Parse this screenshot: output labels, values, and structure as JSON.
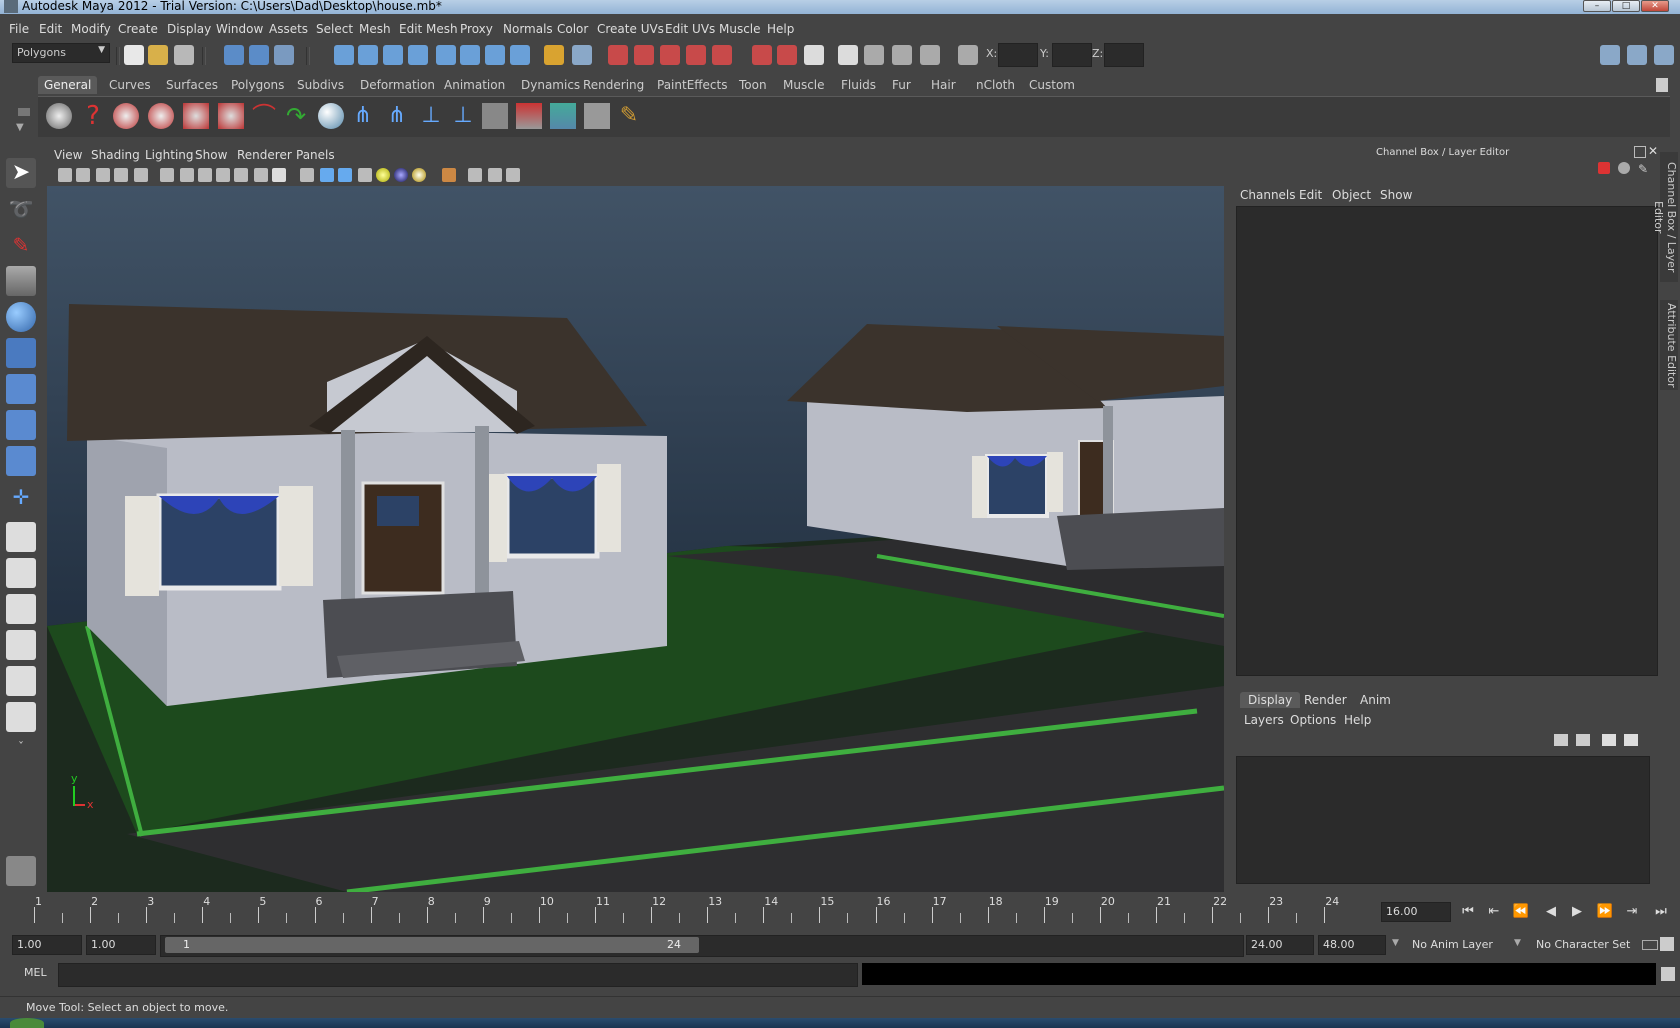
{
  "window": {
    "title": "Autodesk Maya 2012 - Trial Version: C:\\Users\\Dad\\Desktop\\house.mb*",
    "minimize": "–",
    "maximize": "□",
    "close": "✕"
  },
  "menubar": {
    "items": [
      "File",
      "Edit",
      "Modify",
      "Create",
      "Display",
      "Window",
      "Assets",
      "Select",
      "Mesh",
      "Edit Mesh",
      "Proxy",
      "Normals",
      "Color",
      "Create UVs",
      "Edit UVs",
      "Muscle",
      "Help"
    ]
  },
  "statusline": {
    "menuset": "Polygons",
    "x_label": "X:",
    "y_label": "Y:",
    "z_label": "Z:"
  },
  "shelf": {
    "tabs": [
      "General",
      "Curves",
      "Surfaces",
      "Polygons",
      "Subdivs",
      "Deformation",
      "Animation",
      "Dynamics",
      "Rendering",
      "PaintEffects",
      "Toon",
      "Muscle",
      "Fluids",
      "Fur",
      "Hair",
      "nCloth",
      "Custom"
    ],
    "active_tab": "General"
  },
  "viewport": {
    "menu": [
      "View",
      "Shading",
      "Lighting",
      "Show",
      "Renderer",
      "Panels"
    ],
    "axis_x": "x",
    "axis_y": "y"
  },
  "channelbox": {
    "title": "Channel Box / Layer Editor",
    "menu": [
      "Channels",
      "Edit",
      "Object",
      "Show"
    ],
    "side_tab_1": "Channel Box / Layer Editor",
    "side_tab_2": "Attribute Editor"
  },
  "layereditor": {
    "tabs": [
      "Display",
      "Render",
      "Anim"
    ],
    "active_tab": "Display",
    "menu": [
      "Layers",
      "Options",
      "Help"
    ]
  },
  "timeslider": {
    "ticks": [
      "1",
      "2",
      "3",
      "4",
      "5",
      "6",
      "7",
      "8",
      "9",
      "10",
      "11",
      "12",
      "13",
      "14",
      "15",
      "16",
      "17",
      "18",
      "19",
      "20",
      "21",
      "22",
      "23",
      "24"
    ],
    "current_frame": "16.00"
  },
  "rangeslider": {
    "start_time": "1.00",
    "playback_start": "1.00",
    "range_start_label": "1",
    "range_end_label": "24",
    "playback_end": "24.00",
    "end_time": "48.00",
    "anim_layer": "No Anim Layer",
    "character_set": "No Character Set"
  },
  "commandline": {
    "label": "MEL"
  },
  "helpline": {
    "text": "Move Tool: Select an object to move."
  }
}
